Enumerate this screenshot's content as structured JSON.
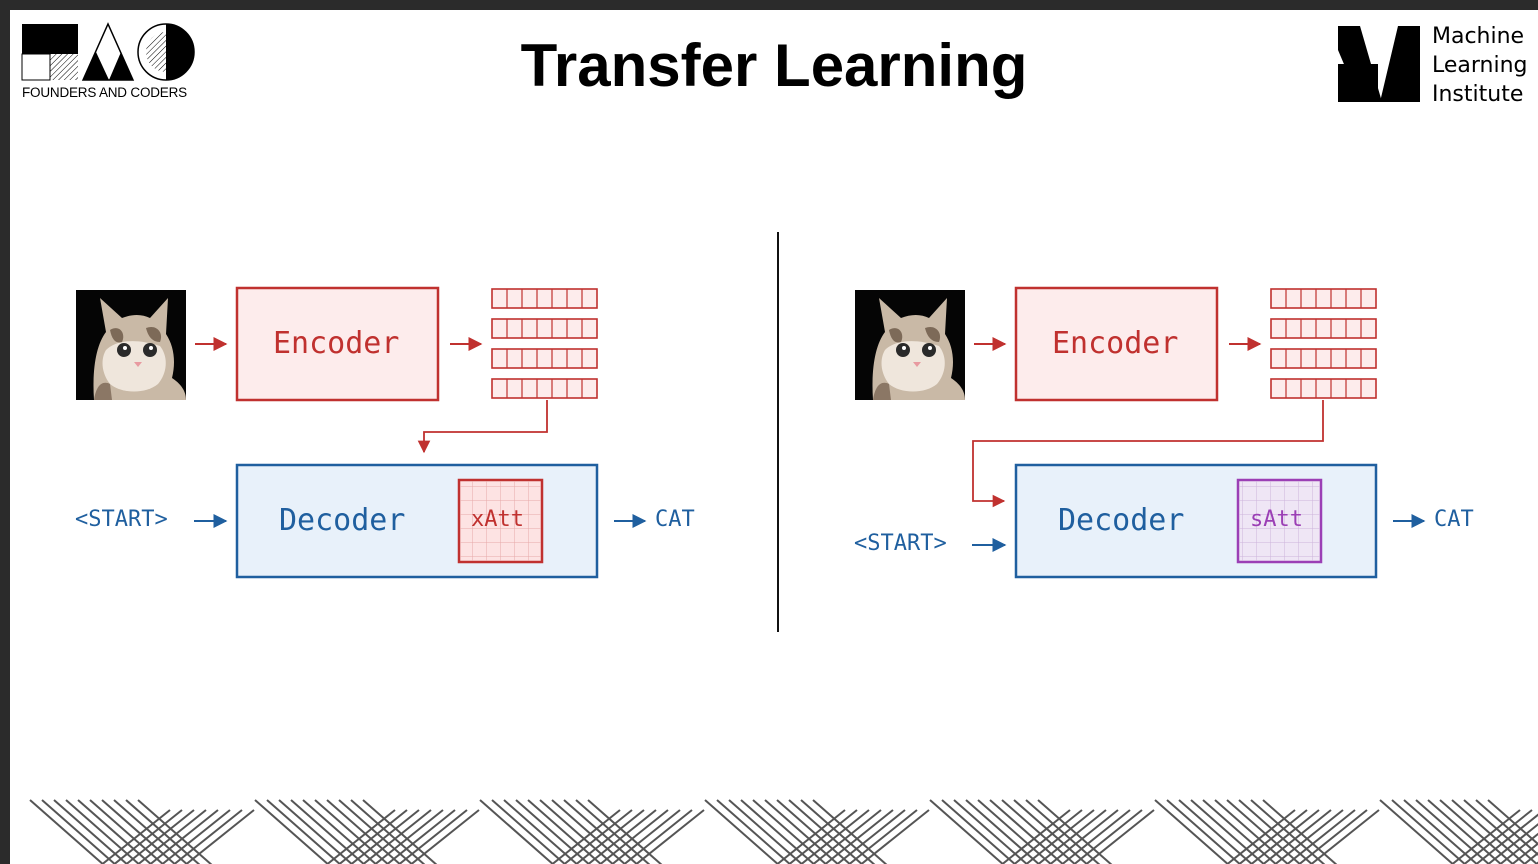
{
  "slide": {
    "title": "Transfer Learning"
  },
  "logos": {
    "founders_and_coders": {
      "caption": "FOUNDERS AND CODERS"
    },
    "machine_learning_institute": {
      "lines": [
        "Machine",
        "Learning",
        "Institute"
      ]
    }
  },
  "left_diagram": {
    "encoder_label": "Encoder",
    "decoder_label": "Decoder",
    "attention_label": "xAtt",
    "input_token": "<START>",
    "output_token": "CAT"
  },
  "right_diagram": {
    "encoder_label": "Encoder",
    "decoder_label": "Decoder",
    "attention_label": "sAtt",
    "input_token": "<START>",
    "output_token": "CAT"
  },
  "colors": {
    "encoder": "#c0312f",
    "encoder_fill": "#fdecec",
    "decoder": "#1f5f9f",
    "decoder_fill": "#e8f1fa",
    "cross_attention": "#c0312f",
    "self_attention": "#9b3fb5",
    "self_attention_fill": "#efe6f5"
  }
}
